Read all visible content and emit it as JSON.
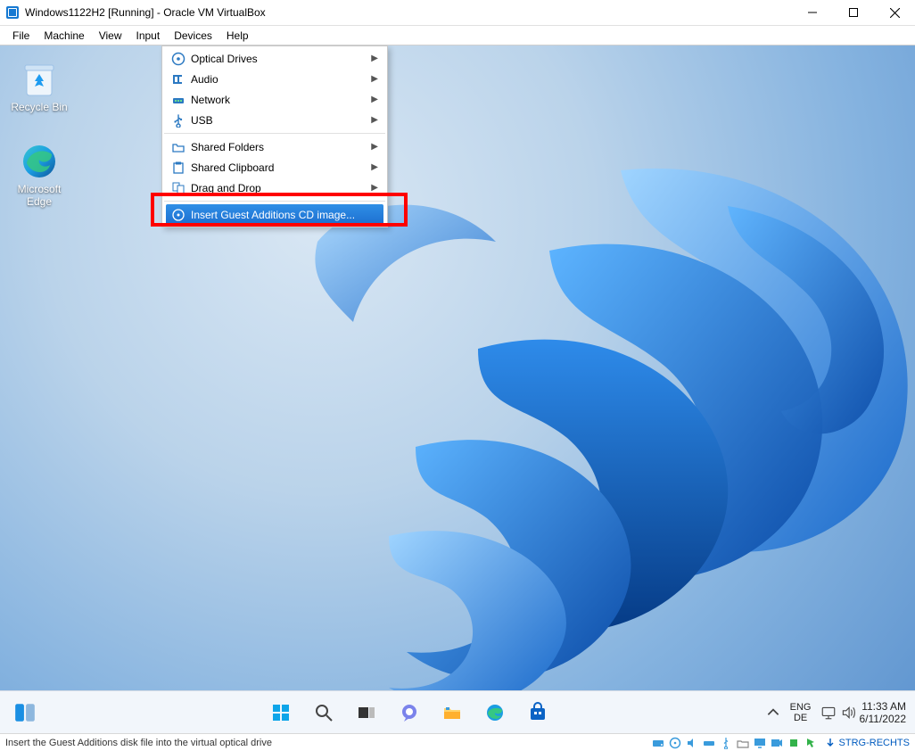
{
  "window": {
    "title": "Windows1122H2 [Running] - Oracle VM VirtualBox"
  },
  "menubar": [
    "File",
    "Machine",
    "View",
    "Input",
    "Devices",
    "Help"
  ],
  "dropdown": {
    "items": [
      {
        "icon": "disc-icon",
        "label": "Optical Drives",
        "submenu": true
      },
      {
        "icon": "audio-icon",
        "label": "Audio",
        "submenu": true
      },
      {
        "icon": "network-icon",
        "label": "Network",
        "submenu": true
      },
      {
        "icon": "usb-icon",
        "label": "USB",
        "submenu": true
      }
    ],
    "items2": [
      {
        "icon": "folder-icon",
        "label": "Shared Folders",
        "submenu": true
      },
      {
        "icon": "clipboard-icon",
        "label": "Shared Clipboard",
        "submenu": true
      },
      {
        "icon": "dragdrop-icon",
        "label": "Drag and Drop",
        "submenu": true
      }
    ],
    "highlighted": {
      "icon": "disc-insert-icon",
      "label": "Insert Guest Additions CD image..."
    }
  },
  "desktop": {
    "recycle_label": "Recycle Bin",
    "edge_label": "Microsoft Edge"
  },
  "taskbar": {
    "lang1": "ENG",
    "lang2": "DE",
    "time": "11:33 AM",
    "date": "6/11/2022"
  },
  "statusbar": {
    "hint": "Insert the Guest Additions disk file into the virtual optical drive",
    "hostkey": "STRG-RECHTS"
  }
}
